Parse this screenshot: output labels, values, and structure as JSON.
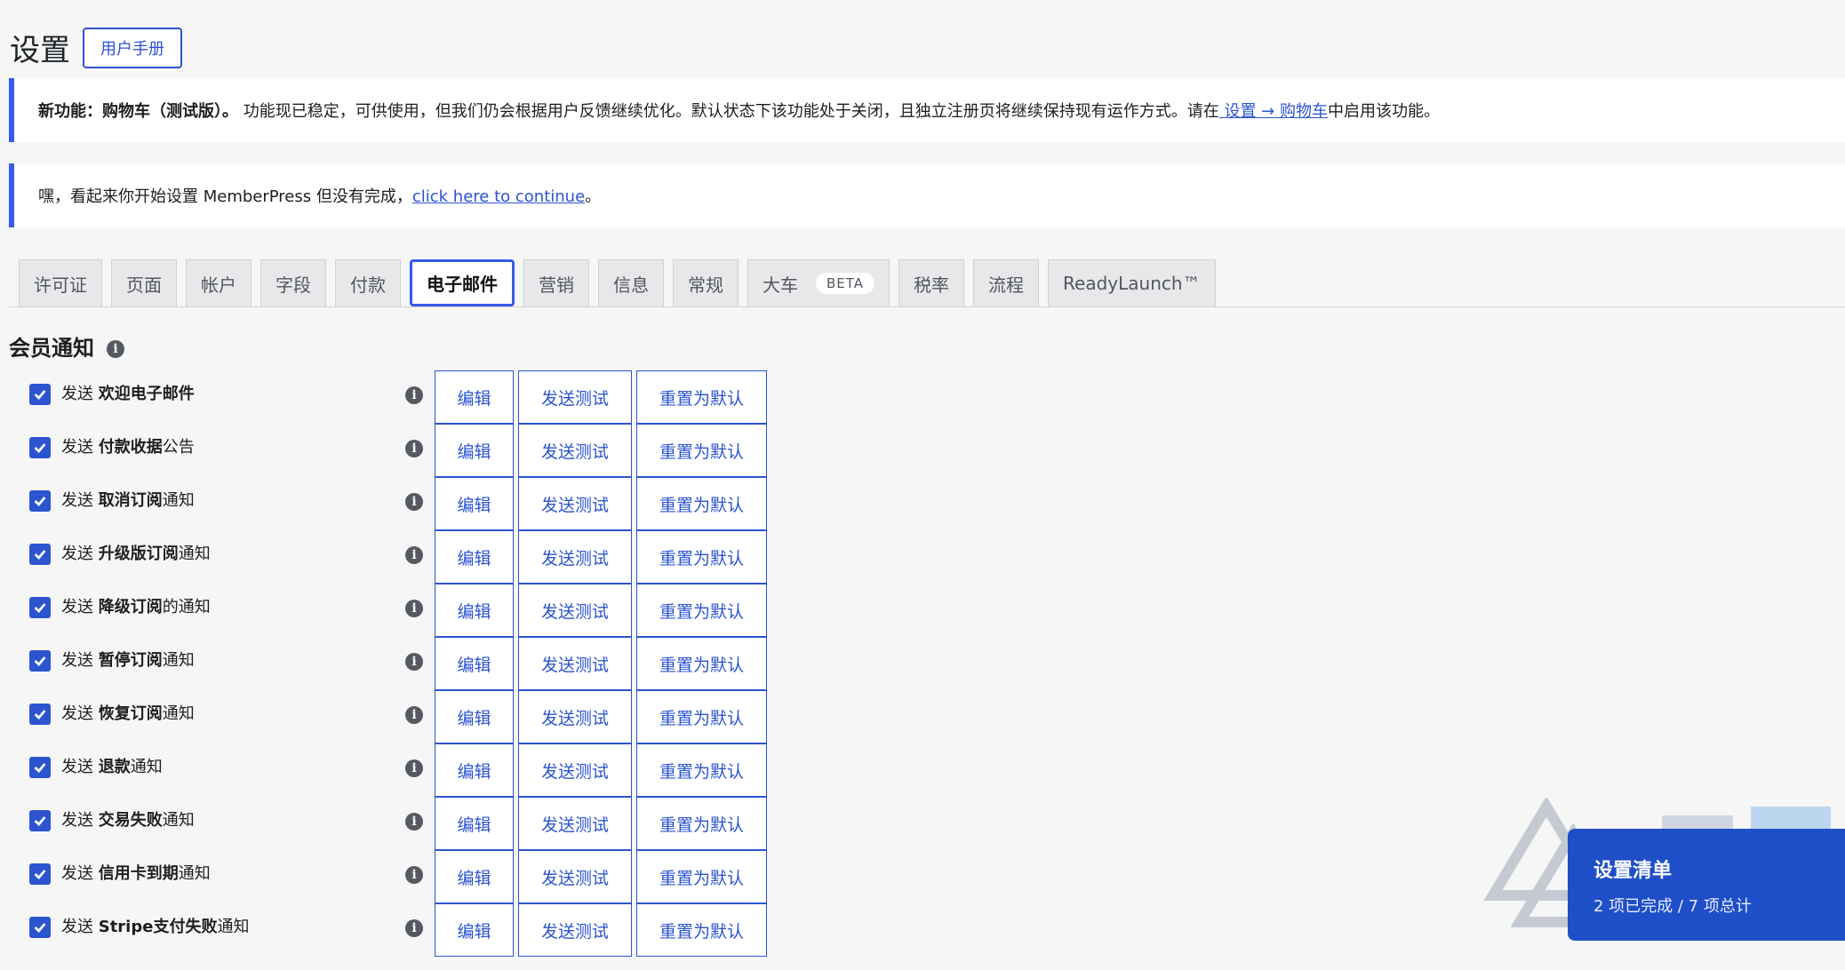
{
  "header": {
    "title": "设置",
    "manual_button": "用户手册"
  },
  "notice_cart": {
    "bold": "新功能：购物车（测试版）。",
    "text": " 功能现已稳定，可供使用，但我们仍会根据用户反馈继续优化。默认状态下该功能处于关闭，且独立注册页将继续保持现有运作方式。请在",
    "link": " 设置 → 购物车",
    "after": "中启用该功能。"
  },
  "notice_setup": {
    "text": "嘿，看起来你开始设置 MemberPress 但没有完成，",
    "link": "click here to continue",
    "after": "。"
  },
  "tabs": [
    {
      "label": "许可证"
    },
    {
      "label": "页面"
    },
    {
      "label": "帐户"
    },
    {
      "label": "字段"
    },
    {
      "label": "付款"
    },
    {
      "label": "电子邮件",
      "active": true
    },
    {
      "label": "营销"
    },
    {
      "label": "信息"
    },
    {
      "label": "常规"
    },
    {
      "label": "大车",
      "badge": "BETA"
    },
    {
      "label": "税率"
    },
    {
      "label": "流程"
    },
    {
      "label": "ReadyLaunch™"
    }
  ],
  "section": {
    "title": "会员通知",
    "info_icon": "info-icon"
  },
  "buttons": {
    "edit": "编辑",
    "test": "发送测试",
    "reset": "重置为默认"
  },
  "notifications": [
    {
      "prefix": "发送 ",
      "bold": "欢迎电子邮件",
      "suffix": "",
      "checked": true
    },
    {
      "prefix": "发送 ",
      "bold": "付款收据",
      "suffix": "公告",
      "checked": true
    },
    {
      "prefix": "发送 ",
      "bold": "取消订阅",
      "suffix": "通知",
      "checked": true
    },
    {
      "prefix": "发送 ",
      "bold": "升级版订阅",
      "suffix": "通知",
      "checked": true
    },
    {
      "prefix": "发送 ",
      "bold": "降级订阅",
      "suffix": "的通知",
      "checked": true
    },
    {
      "prefix": "发送 ",
      "bold": "暂停订阅",
      "suffix": "通知",
      "checked": true
    },
    {
      "prefix": "发送 ",
      "bold": "恢复订阅",
      "suffix": "通知",
      "checked": true
    },
    {
      "prefix": "发送 ",
      "bold": "退款",
      "suffix": "通知",
      "checked": true
    },
    {
      "prefix": "发送 ",
      "bold": "交易失败",
      "suffix": "通知",
      "checked": true
    },
    {
      "prefix": "发送 ",
      "bold": "信用卡到期",
      "suffix": "通知",
      "checked": true
    },
    {
      "prefix": "发送 ",
      "bold": "Stripe支付失败",
      "suffix": "通知",
      "checked": true
    }
  ],
  "checklist": {
    "title": "设置清单",
    "progress": "2 项已完成 / 7 项总计"
  },
  "colors": {
    "accent": "#2c54d1",
    "notice_border": "#3858e9",
    "checklist_bg": "#1e4fc8"
  }
}
